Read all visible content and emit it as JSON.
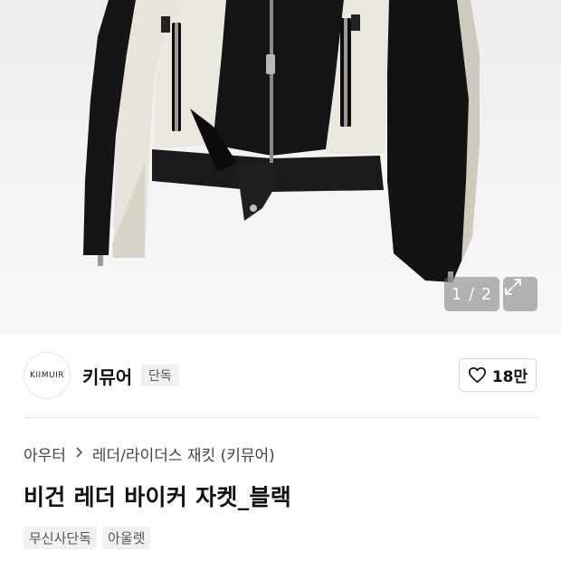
{
  "gallery": {
    "counter": "1 / 2",
    "expand_icon": "expand-icon"
  },
  "brand": {
    "logo_text": "KIIMUIR",
    "name": "키뮤어",
    "badge": "단독",
    "like_icon": "heart-icon",
    "like_count": "18만"
  },
  "breadcrumb": {
    "category": "아우터",
    "separator_icon": "chevron-right-icon",
    "subcategory": "레더/라이더스 재킷 (키뮤어)"
  },
  "product": {
    "title": "비건 레더 바이커 자켓_블랙",
    "tags": [
      "무신사단독",
      "아울렛"
    ]
  }
}
